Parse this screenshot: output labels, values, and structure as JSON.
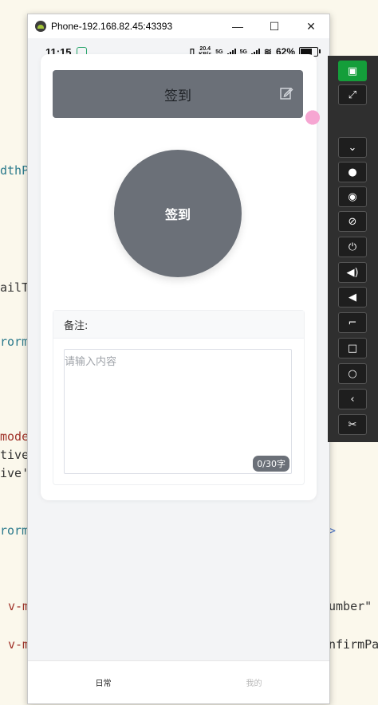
{
  "window": {
    "title": "Phone-192.168.82.45:43393",
    "minimize": "—",
    "maximize": "☐",
    "close": "✕"
  },
  "status_bar": {
    "time": "11:15",
    "net_speed": "20.4\nKB/s",
    "signal1": "5G",
    "signal2": "5G",
    "battery": "62%"
  },
  "checkin": {
    "header_title": "签到",
    "button_label": "签到"
  },
  "remark": {
    "label": "备注:",
    "placeholder": "请输入内容",
    "counter": "0/30字"
  },
  "tabs": [
    {
      "label": "日常",
      "active": true
    },
    {
      "label": "我的",
      "active": false
    }
  ],
  "background_code": [
    "dthP",
    "ailT",
    "rorm",
    "mode",
    "tive",
    "ive'",
    "rorm",
    "v-m",
    "umber\"",
    "v-m",
    "nfirmPa",
    ">"
  ],
  "panel_buttons": [
    "android-icon",
    "fullscreen-icon",
    "expand-icon",
    "record-icon",
    "eye-icon",
    "eye-off-icon",
    "power-icon",
    "volume-up-icon",
    "volume-down-icon",
    "crop-icon",
    "square-icon",
    "circle-icon",
    "back-icon",
    "scissors-icon"
  ],
  "colors": {
    "accent_gray": "#6b7078",
    "panel_green": "#149e3a"
  }
}
